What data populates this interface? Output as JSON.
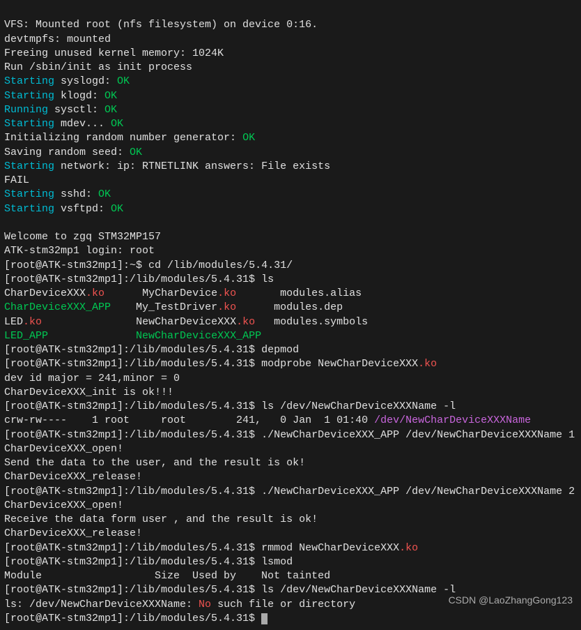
{
  "boot": {
    "l1": "VFS: Mounted root (nfs filesystem) on device 0:16.",
    "l2": "devtmpfs: mounted",
    "l3": "Freeing unused kernel memory: 1024K",
    "l4": "Run /sbin/init as init process"
  },
  "svc": {
    "starting": "Starting",
    "running": "Running",
    "syslogd": " syslogd: ",
    "klogd": " klogd: ",
    "sysctl": " sysctl: ",
    "mdev": " mdev... ",
    "ok": "OK",
    "initrng": "Initializing random number generator: ",
    "seed": "Saving random seed: ",
    "net": " network: ip: RTNETLINK answers: File exists",
    "fail": "FAIL",
    "sshd": " sshd: ",
    "vsftpd": " vsftpd: "
  },
  "login": {
    "welcome": "Welcome to zgq STM32MP157",
    "prompt": "ATK-stm32mp1 login: root"
  },
  "prompts": {
    "home": "[root@ATK-stm32mp1]:~$ ",
    "mod": "[root@ATK-stm32mp1]:/lib/modules/5.4.31$ "
  },
  "cmds": {
    "cd": "cd /lib/modules/5.4.31/",
    "ls": "ls",
    "depmod": "depmod",
    "modprobe": "modprobe NewCharDeviceXXX",
    "lsdev": "ls /dev/NewCharDeviceXXXName -l",
    "runapp1": "./NewCharDeviceXXX_APP /dev/NewCharDeviceXXXName 1",
    "runapp2": "./NewCharDeviceXXX_APP /dev/NewCharDeviceXXXName 2",
    "rmmod": "rmmod NewCharDeviceXXX",
    "lsmod": "lsmod",
    "lsdev2": "ls /dev/NewCharDeviceXXXName -l"
  },
  "ko": ".ko",
  "listing": {
    "r1c1": "CharDeviceXXX",
    "r1c2": "MyCharDevice",
    "r1c3": "modules.alias",
    "r2c1": "CharDeviceXXX_APP",
    "r2c2": "My_TestDriver",
    "r2c3": "modules.dep",
    "r3c1": "LED",
    "r3c2": "NewCharDeviceXXX",
    "r3c3": "modules.symbols",
    "r4c1": "LED_APP",
    "r4c2": "NewCharDeviceXXX_APP"
  },
  "out": {
    "devid": "dev id major = 241,minor = 0",
    "initok": "CharDeviceXXX_init is ok!!!",
    "lsdev_line_a": "crw-rw----    1 root     root        241,   0 Jan  1 01:40 ",
    "lsdev_link": "/dev/NewCharDeviceXXXName",
    "open": "CharDeviceXXX_open!",
    "send": "Send the data to the user, and the result is ok!",
    "release": "CharDeviceXXX_release!",
    "recv": "Receive the data form user , and the result is ok!",
    "lsmod_hdr": "Module                  Size  Used by    Not tainted",
    "err_pre": "ls: /dev/NewCharDeviceXXXName: ",
    "err_no": "No",
    "err_post": " such file or directory"
  },
  "watermark": "CSDN @LaoZhangGong123"
}
